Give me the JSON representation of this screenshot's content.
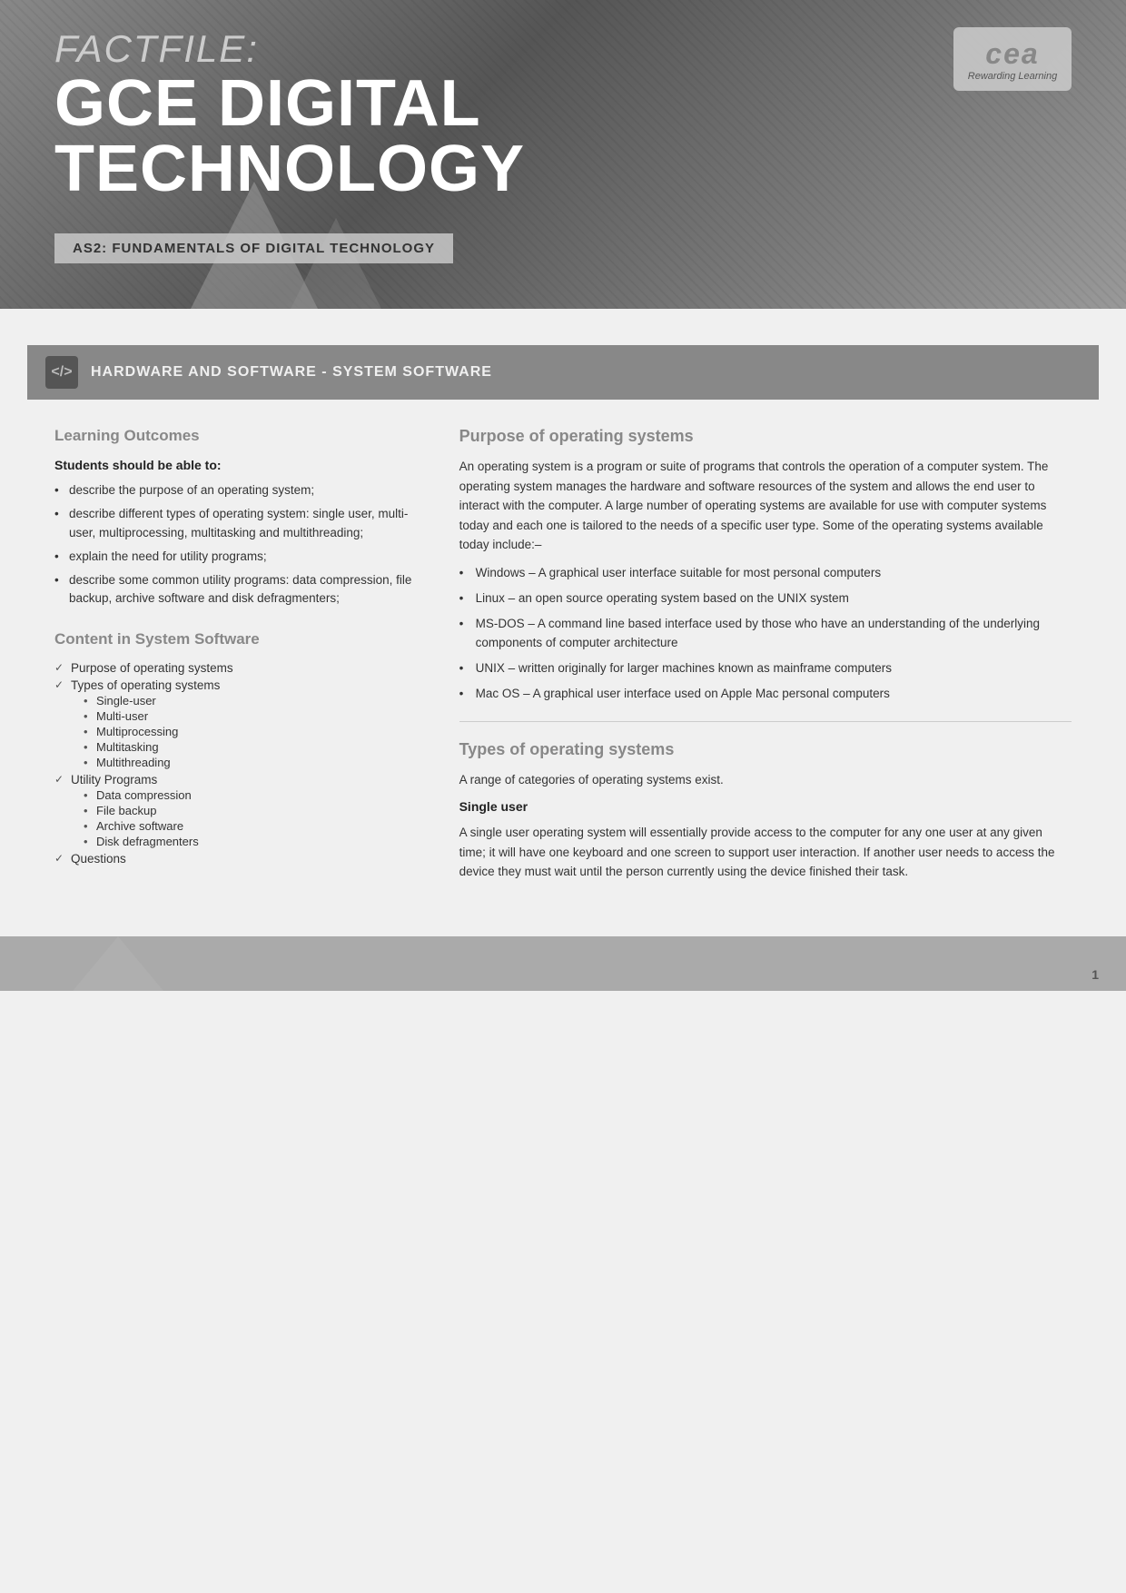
{
  "header": {
    "factfile_label": "FACTFILE:",
    "title_line1": "GCE DIGITAL",
    "title_line2": "TECHNOLOGY",
    "subtitle": "AS2: FUNDAMENTALS OF DIGITAL TECHNOLOGY",
    "cea_logo_text": "cea",
    "cea_logo_sub": "Rewarding Learning"
  },
  "section_header": {
    "icon_text": "</> ",
    "title": "HARDWARE AND SOFTWARE - SYSTEM SOFTWARE"
  },
  "left_column": {
    "learning_outcomes_heading": "Learning Outcomes",
    "students_label": "Students should be able to:",
    "outcomes": [
      "describe the purpose of an operating system;",
      "describe different types of operating system: single user, multi-user, multiprocessing, multitasking and multithreading;",
      "explain the need for utility programs;",
      "describe some common utility programs: data compression, file backup, archive software and disk defragmenters;"
    ],
    "content_heading": "Content in System Software",
    "toc_items": [
      {
        "label": "Purpose of operating systems",
        "subs": []
      },
      {
        "label": "Types of operating systems",
        "subs": [
          "Single-user",
          "Multi-user",
          "Multiprocessing",
          "Multitasking",
          "Multithreading"
        ]
      },
      {
        "label": "Utility Programs",
        "subs": [
          "Data compression",
          "File backup",
          "Archive software",
          "Disk defragmenters"
        ]
      },
      {
        "label": "Questions",
        "subs": []
      }
    ]
  },
  "right_column": {
    "purpose_heading": "Purpose of operating systems",
    "purpose_body": "An operating system is a program or suite of programs that controls the operation of a computer system. The operating system manages the hardware and software resources of the system and allows the end user to interact with the computer. A large number of operating systems are available for use with computer systems today and each one is tailored to the needs of a specific user type. Some of the operating systems available today include:–",
    "os_items": [
      "Windows – A graphical user interface suitable for most personal computers",
      "Linux – an open source operating system based on the UNIX system",
      "MS-DOS – A command line based interface used by those who have an understanding of the underlying components of computer architecture",
      "UNIX – written originally for larger machines known as mainframe computers",
      "Mac OS – A graphical user interface used on Apple Mac personal computers"
    ],
    "types_heading": "Types of operating systems",
    "types_intro": "A range of categories of operating systems exist.",
    "single_user_heading": "Single user",
    "single_user_body": "A single user operating system will essentially provide access to the computer for any one user at any given time; it will have one keyboard and one screen to support user interaction. If another user needs to access the device they must wait until the person currently using the device finished their task."
  },
  "footer": {
    "page_number": "1"
  }
}
